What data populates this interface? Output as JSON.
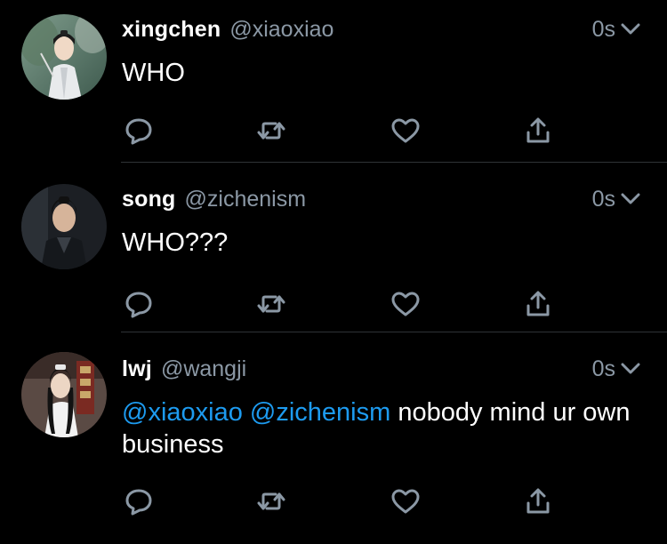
{
  "colors": {
    "background": "#000000",
    "text": "#ffffff",
    "secondary": "#8b98a5",
    "mention": "#1d9bf0",
    "divider": "#2f3336"
  },
  "tweets": [
    {
      "display_name": "xingchen",
      "handle": "@xiaoxiao",
      "time": "0s",
      "text": "WHO",
      "icons": [
        "reply-icon",
        "retweet-icon",
        "like-icon",
        "share-icon"
      ]
    },
    {
      "display_name": "song",
      "handle": "@zichenism",
      "time": "0s",
      "text": "WHO???",
      "icons": [
        "reply-icon",
        "retweet-icon",
        "like-icon",
        "share-icon"
      ]
    },
    {
      "display_name": "lwj",
      "handle": "@wangji",
      "time": "0s",
      "mentions": [
        "@xiaoxiao",
        "@zichenism"
      ],
      "text": "nobody mind ur own business",
      "icons": [
        "reply-icon",
        "retweet-icon",
        "like-icon",
        "share-icon"
      ]
    }
  ]
}
